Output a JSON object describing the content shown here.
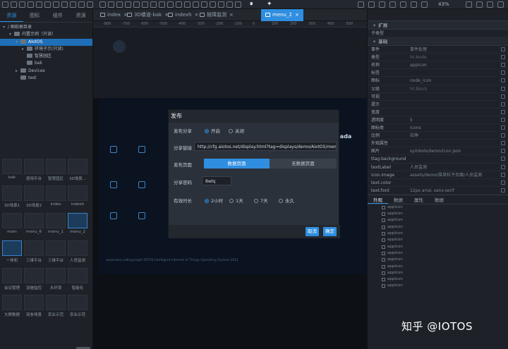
{
  "toolbar": {
    "zoom": "43%"
  },
  "left": {
    "tabs": [
      "资源",
      "图标",
      "组件",
      "资源"
    ],
    "tree": [
      {
        "label": "/ 图纸根目录",
        "depth": 0,
        "caret": "▾",
        "folder": false,
        "selected": false
      },
      {
        "label": "内置示例（只读）",
        "depth": 1,
        "caret": "▾",
        "folder": true,
        "selected": false
      },
      {
        "label": "AIotOS",
        "depth": 2,
        "caret": "▾",
        "folder": true,
        "selected": true
      },
      {
        "label": "环境子示(只读)",
        "depth": 3,
        "caret": "▸",
        "folder": true,
        "selected": false
      },
      {
        "label": "智慧园区",
        "depth": 3,
        "caret": "",
        "folder": true,
        "selected": false
      },
      {
        "label": "bak",
        "depth": 3,
        "caret": "",
        "folder": true,
        "selected": false
      },
      {
        "label": "Devices",
        "depth": 2,
        "caret": "▸",
        "folder": true,
        "selected": false
      },
      {
        "label": "test",
        "depth": 2,
        "caret": "",
        "folder": true,
        "selected": false
      }
    ],
    "thumb_labels": [
      [
        "bak",
        "按用平台",
        "智慧园区",
        "3D场景..."
      ],
      [
        "3D场景1",
        "3D场景2",
        "index",
        "indexh"
      ],
      [
        "main",
        "menu_6",
        "menu_1",
        "menu_2"
      ],
      [
        "一体机",
        "三维平台",
        "三维平台",
        "人员监测"
      ],
      [
        "会议管理",
        "设施监控",
        "水环境",
        "智能化"
      ],
      [
        "大屏数据",
        "双参场景",
        "农业示范",
        "农业示范"
      ]
    ]
  },
  "doctabs": [
    {
      "label": "index",
      "active": false
    },
    {
      "label": "3D楼道-bak",
      "active": false
    },
    {
      "label": "indexh",
      "active": false
    },
    {
      "label": "故障监测",
      "active": false
    },
    {
      "label": "menu_2",
      "active": true
    }
  ],
  "ruler": [
    "-800",
    "-700",
    "-600",
    "-500",
    "-400",
    "-300",
    "-200",
    "-100",
    "0",
    "100",
    "200",
    "300",
    "400",
    "500"
  ],
  "canvas": {
    "brand": "IOTOSada",
    "footer_left": "www.iotos.net",
    "footer_right": "Copyright IOTOS Intelligent Internet of Things Operating System 2021"
  },
  "dialog": {
    "title": "发布",
    "share_label": "发布分享",
    "share_on": "开启",
    "share_off": "关闭",
    "link_label": "分享链接",
    "link_value": "http://cfg.aiotos.net/display.html?tag=displays/demo/AiotOS/menu_2",
    "page_label": "发布页面",
    "page_on": "数据页面",
    "page_off": "无数据页面",
    "pwd_label": "分享密码",
    "pwd_value": "8wlq",
    "dur_label": "有效时长",
    "durations": [
      "2小时",
      "1天",
      "7天",
      "永久"
    ],
    "cancel": "取消",
    "ok": "确定"
  },
  "right": {
    "section_top": "扩展",
    "type_row": {
      "key": "子类型",
      "value": ""
    },
    "section_base": "基础",
    "props": [
      {
        "key": "事件",
        "value": "事件处理",
        "dim": false
      },
      {
        "key": "类型",
        "value": "ht.Node",
        "dim": true
      },
      {
        "key": "名称",
        "value": "appIcon",
        "dim": false
      },
      {
        "key": "标签",
        "value": "",
        "dim": false
      },
      {
        "key": "图标",
        "value": "node_icon",
        "dim": false
      },
      {
        "key": "父级",
        "value": "ht.Block",
        "dim": true
      },
      {
        "key": "可视",
        "value": "",
        "dim": false
      },
      {
        "key": "提示",
        "value": "",
        "dim": false
      },
      {
        "key": "宽度",
        "value": "",
        "dim": false
      },
      {
        "key": "透明度",
        "value": "5",
        "dim": false
      },
      {
        "key": "图标类",
        "value": "icons",
        "dim": false
      },
      {
        "key": "比例",
        "value": "拉伸",
        "dim": false
      },
      {
        "key": "外观属性",
        "value": "",
        "dim": false
      },
      {
        "key": "图片",
        "value": "symbols/demo/icon.json",
        "dim": false
      },
      {
        "key": "ttag.background",
        "value": "",
        "dim": false
      },
      {
        "key": "textLabel",
        "value": "人员监测",
        "dim": false
      },
      {
        "key": "icon.image",
        "value": "assets/demo/菜单栏子页面/人员监测",
        "dim": false
      },
      {
        "key": "text.color",
        "value": "",
        "dim": false
      },
      {
        "key": "text.font",
        "value": "12px arial, sans-serif",
        "dim": false
      }
    ],
    "tabs": [
      "外观",
      "数据",
      "属性",
      "数据"
    ],
    "layer_items": [
      "appIcon",
      "appIcon",
      "appIcon",
      "appIcon",
      "appIcon",
      "appIcon",
      "appIcon",
      "appIcon",
      "appIcon",
      "appIcon",
      "appIcon",
      "appIcon",
      "appIcon"
    ]
  },
  "watermark": "知乎 @IOTOS"
}
